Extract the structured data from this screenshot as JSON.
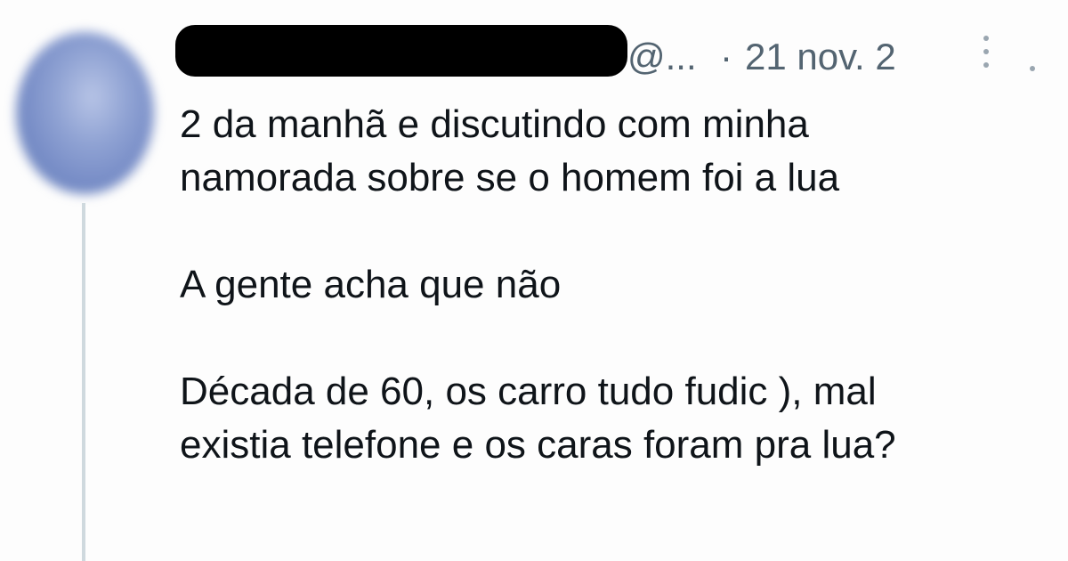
{
  "tweet": {
    "handle": "@...",
    "separator": "·",
    "date": "21 nov. 2",
    "lines": [
      "2 da manhã e discutindo com minha",
      "namorada sobre se o homem foi a lua",
      "A gente acha que não",
      "Década de 60, os carro tudo fudic ), mal",
      "existia telefone e os caras foram pra lua?"
    ]
  },
  "icons": {
    "avatar": "avatar-blurred",
    "more": "more-vertical-icon"
  }
}
